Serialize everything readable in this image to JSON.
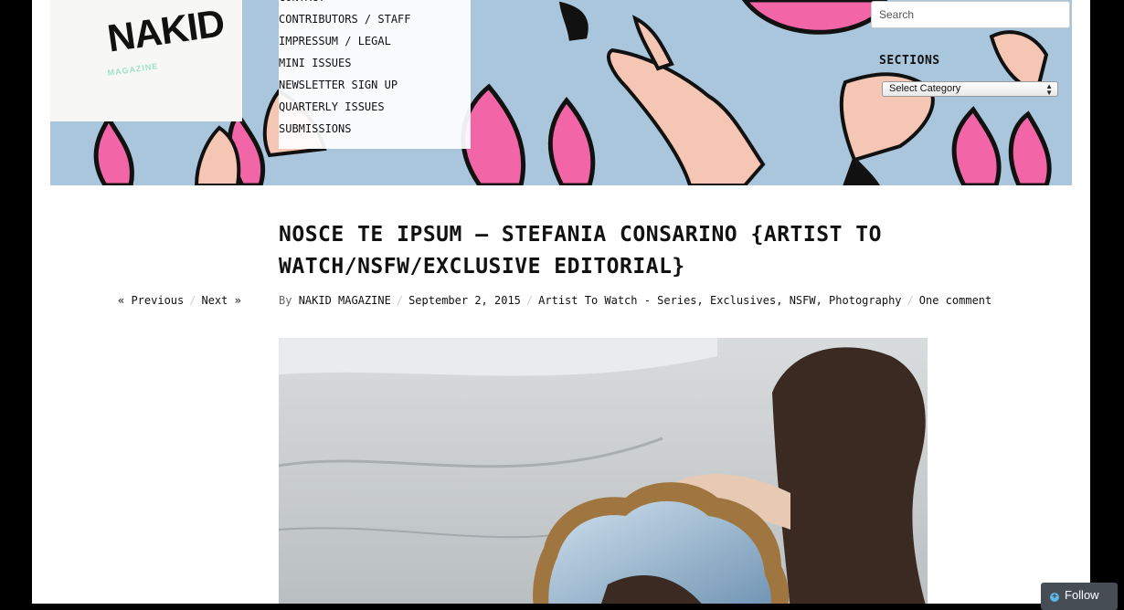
{
  "header": {
    "logo_text": "NAKID",
    "logo_subtext": "MAGAZINE",
    "menu_items": [
      "CONTACT",
      "CONTRIBUTORS / STAFF",
      "IMPRESSUM / LEGAL",
      "MINI ISSUES",
      "NEWSLETTER SIGN UP",
      "QUARTERLY ISSUES",
      "SUBMISSIONS"
    ],
    "search_placeholder": "Search",
    "sections_title": "SECTIONS",
    "category_select": "Select Category"
  },
  "post": {
    "title_line1": "NOSCE TE IPSUM – STEFANIA CONSARINO {ARTIST TO",
    "title_line2": "WATCH/NSFW/EXCLUSIVE EDITORIAL}",
    "nav": {
      "previous": "« Previous",
      "separator": "/",
      "next": "Next »"
    },
    "meta": {
      "by_label": "By",
      "author": "NAKID MAGAZINE",
      "date": "September 2, 2015",
      "categories": [
        "Artist To Watch - Series",
        "Exclusives",
        "NSFW",
        "Photography"
      ],
      "comments": "One comment"
    }
  },
  "follow_label": "Follow",
  "colors": {
    "banner_blue": "#a9c6dd",
    "pink": "#f266a8",
    "skin": "#f6c6b4",
    "follow_bg": "#464d55"
  }
}
